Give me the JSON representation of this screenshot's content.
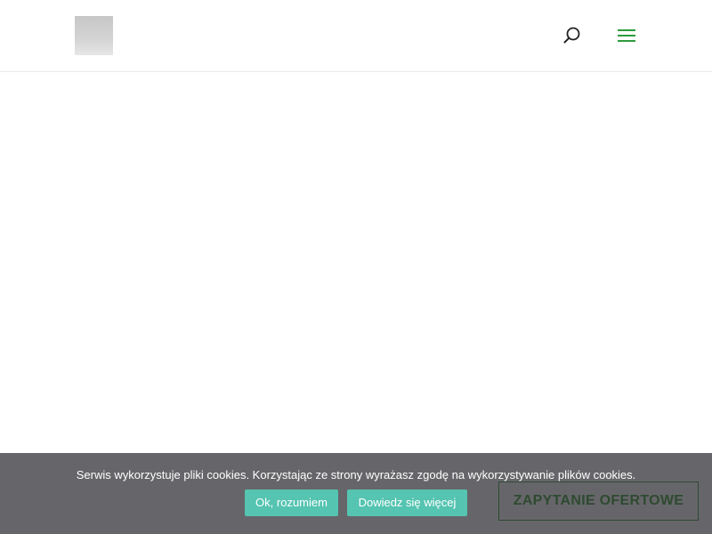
{
  "header": {
    "logo": "logo-placeholder",
    "search_icon": "search-icon",
    "menu_icon": "hamburger-menu-icon",
    "accent_color": "#2e9b3e"
  },
  "cookie_bar": {
    "message": "Serwis wykorzystuje pliki cookies. Korzystając ze strony wyrażasz zgodę na wykorzystywanie plików cookies.",
    "accept_label": "Ok, rozumiem",
    "more_label": "Dowiedz się więcej",
    "close_icon": "close-icon",
    "button_color": "#55c4b1"
  },
  "inquiry": {
    "label": "ZAPYTANIE OFERTOWE",
    "color": "#2e4a30"
  }
}
